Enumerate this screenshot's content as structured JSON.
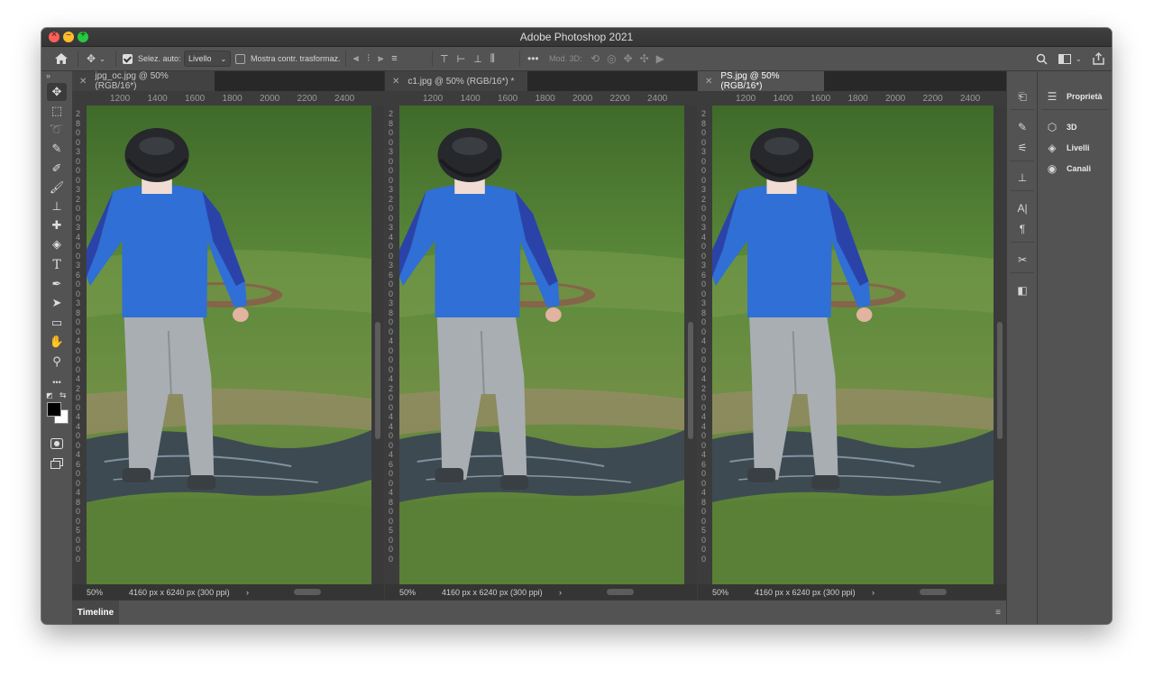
{
  "window": {
    "title": "Adobe Photoshop 2021"
  },
  "options_bar": {
    "auto_select_label": "Selez. auto:",
    "auto_select_value": "Livello",
    "show_transform_label": "Mostra contr. trasformaz.",
    "mode_3d_label": "Mod. 3D:",
    "more_label": "•••"
  },
  "panes": [
    {
      "tab": "jpg_oc.jpg @ 50% (RGB/16*)",
      "zoom": "50%",
      "size": "4160 px x 6240 px (300 ppi)",
      "active": false,
      "ruler_h": [
        "1200",
        "1400",
        "1600",
        "1800",
        "2000",
        "2200",
        "2400"
      ],
      "ruler_v": [
        "2",
        "8",
        "0",
        "0",
        "3",
        "0",
        "0",
        "0",
        "3",
        "2",
        "0",
        "0",
        "3",
        "4",
        "0",
        "0",
        "3",
        "6",
        "0",
        "0",
        "3",
        "8",
        "0",
        "0",
        "4",
        "0",
        "0",
        "0",
        "4",
        "2",
        "0",
        "0",
        "4",
        "4",
        "0",
        "0",
        "4",
        "6",
        "0",
        "0",
        "4",
        "8",
        "0",
        "0",
        "5",
        "0",
        "0",
        "0"
      ]
    },
    {
      "tab": "c1.jpg @ 50% (RGB/16*) *",
      "zoom": "50%",
      "size": "4160 px x 6240 px (300 ppi)",
      "active": false,
      "ruler_h": [
        "1200",
        "1400",
        "1600",
        "1800",
        "2000",
        "2200",
        "2400"
      ],
      "ruler_v": [
        "2",
        "8",
        "0",
        "0",
        "3",
        "0",
        "0",
        "0",
        "3",
        "2",
        "0",
        "0",
        "3",
        "4",
        "0",
        "0",
        "3",
        "6",
        "0",
        "0",
        "3",
        "8",
        "0",
        "0",
        "4",
        "0",
        "0",
        "0",
        "4",
        "2",
        "0",
        "0",
        "4",
        "4",
        "0",
        "0",
        "4",
        "6",
        "0",
        "0",
        "4",
        "8",
        "0",
        "0",
        "5",
        "0",
        "0",
        "0"
      ]
    },
    {
      "tab": "PS.jpg @ 50% (RGB/16*)",
      "zoom": "50%",
      "size": "4160 px x 6240 px (300 ppi)",
      "active": true,
      "ruler_h": [
        "1200",
        "1400",
        "1600",
        "1800",
        "2000",
        "2200",
        "2400"
      ],
      "ruler_v": [
        "2",
        "8",
        "0",
        "0",
        "3",
        "0",
        "0",
        "0",
        "3",
        "2",
        "0",
        "0",
        "3",
        "4",
        "0",
        "0",
        "3",
        "6",
        "0",
        "0",
        "3",
        "8",
        "0",
        "0",
        "4",
        "0",
        "0",
        "0",
        "4",
        "2",
        "0",
        "0",
        "4",
        "4",
        "0",
        "0",
        "4",
        "6",
        "0",
        "0",
        "4",
        "8",
        "0",
        "0",
        "5",
        "0",
        "0",
        "0"
      ]
    }
  ],
  "status_arrow": "›",
  "timeline": {
    "label": "Timeline"
  },
  "right_panels": {
    "items": [
      {
        "label": "Proprietà",
        "icon": "sliders-icon"
      },
      {
        "label": "3D",
        "icon": "cube-icon"
      },
      {
        "label": "Livelli",
        "icon": "layers-icon"
      },
      {
        "label": "Canali",
        "icon": "channels-icon"
      }
    ]
  },
  "tools": [
    {
      "name": "move-tool-icon",
      "glyph": "✥"
    },
    {
      "name": "marquee-tool-icon",
      "glyph": "⬚"
    },
    {
      "name": "lasso-tool-icon",
      "glyph": "➰"
    },
    {
      "name": "quick-select-tool-icon",
      "glyph": "✎"
    },
    {
      "name": "eyedropper-tool-icon",
      "glyph": "✐"
    },
    {
      "name": "brush-tool-icon",
      "glyph": "🖌"
    },
    {
      "name": "stamp-tool-icon",
      "glyph": "⊥"
    },
    {
      "name": "healing-tool-icon",
      "glyph": "✚"
    },
    {
      "name": "gradient-tool-icon",
      "glyph": "◈"
    },
    {
      "name": "type-tool-icon",
      "glyph": "T"
    },
    {
      "name": "pen-tool-icon",
      "glyph": "✒"
    },
    {
      "name": "path-select-tool-icon",
      "glyph": "➤"
    },
    {
      "name": "rectangle-tool-icon",
      "glyph": "▭"
    },
    {
      "name": "hand-tool-icon",
      "glyph": "✋"
    },
    {
      "name": "zoom-tool-icon",
      "glyph": "⚲"
    },
    {
      "name": "more-tools-icon",
      "glyph": "•••"
    }
  ],
  "colors": {
    "foreground": "#000000",
    "background": "#ffffff",
    "accent": "#3b3b3b"
  }
}
